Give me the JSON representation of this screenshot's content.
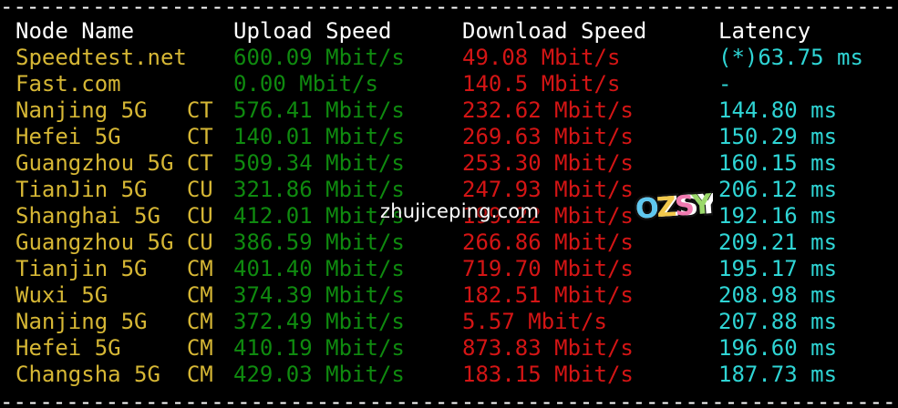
{
  "colors": {
    "background": "#000000",
    "header": "#ffffff",
    "node_name": "#d6b735",
    "upload": "#0f8a0f",
    "download": "#d41515",
    "latency": "#2fd5d5"
  },
  "rules": {
    "top": "-----------------------------------------------------------------------------------------------",
    "bottom": "-----------------------------------------------------------------------------------------------"
  },
  "header": {
    "node_name": "Node Name",
    "upload_speed": "Upload Speed",
    "download_speed": "Download Speed",
    "latency": "Latency"
  },
  "rows": [
    {
      "node": "Speedtest.net",
      "upload": "600.09 Mbit/s",
      "download": "49.08 Mbit/s",
      "latency": "(*)63.75 ms"
    },
    {
      "node": "Fast.com",
      "upload": "0.00 Mbit/s",
      "download": "140.5 Mbit/s",
      "latency": "-"
    },
    {
      "node": "Nanjing 5G   CT",
      "upload": "576.41 Mbit/s",
      "download": "232.62 Mbit/s",
      "latency": "144.80 ms"
    },
    {
      "node": "Hefei 5G     CT",
      "upload": "140.01 Mbit/s",
      "download": "269.63 Mbit/s",
      "latency": "150.29 ms"
    },
    {
      "node": "Guangzhou 5G CT",
      "upload": "509.34 Mbit/s",
      "download": "253.30 Mbit/s",
      "latency": "160.15 ms"
    },
    {
      "node": "TianJin 5G   CU",
      "upload": "321.86 Mbit/s",
      "download": "247.93 Mbit/s",
      "latency": "206.12 ms"
    },
    {
      "node": "Shanghai 5G  CU",
      "upload": "412.01 Mbit/s",
      "download": "199.22 Mbit/s",
      "latency": "192.16 ms"
    },
    {
      "node": "Guangzhou 5G CU",
      "upload": "386.59 Mbit/s",
      "download": "266.86 Mbit/s",
      "latency": "209.21 ms"
    },
    {
      "node": "Tianjin 5G   CM",
      "upload": "401.40 Mbit/s",
      "download": "719.70 Mbit/s",
      "latency": "195.17 ms"
    },
    {
      "node": "Wuxi 5G      CM",
      "upload": "374.39 Mbit/s",
      "download": "182.51 Mbit/s",
      "latency": "208.98 ms"
    },
    {
      "node": "Nanjing 5G   CM",
      "upload": "372.49 Mbit/s",
      "download": "5.57 Mbit/s",
      "latency": "207.88 ms"
    },
    {
      "node": "Hefei 5G     CM",
      "upload": "410.19 Mbit/s",
      "download": "873.83 Mbit/s",
      "latency": "196.60 ms"
    },
    {
      "node": "Changsha 5G  CM",
      "upload": "429.03 Mbit/s",
      "download": "183.15 Mbit/s",
      "latency": "187.73 ms"
    }
  ],
  "watermark": {
    "text": "zhujiceping.com",
    "logo_text": "OZSY"
  }
}
